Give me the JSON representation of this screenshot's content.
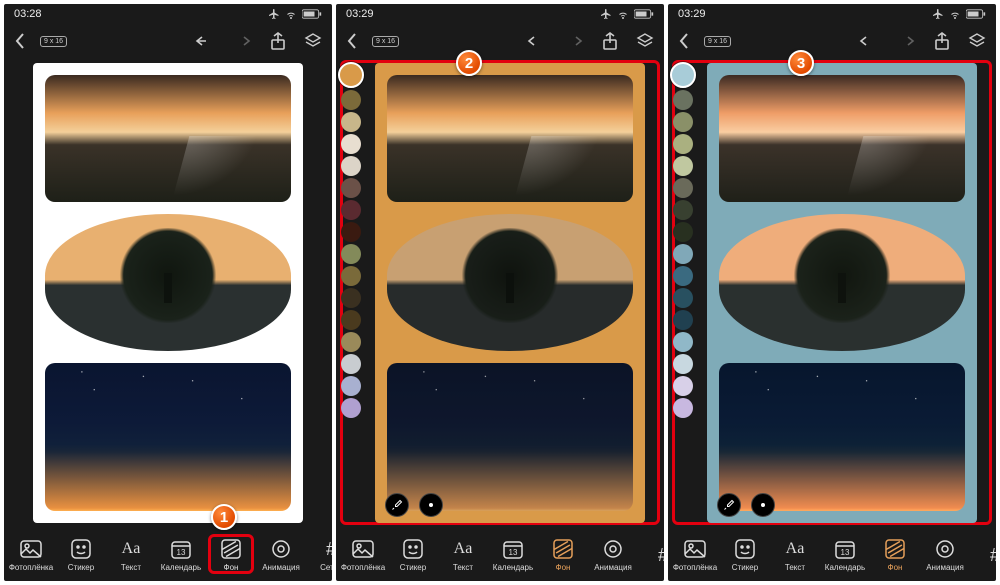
{
  "status": {
    "time1": "03:28",
    "time2": "03:29",
    "time3": "03:29"
  },
  "aspect": {
    "label": "9 x 16"
  },
  "badges": {
    "one": "1",
    "two": "2",
    "three": "3"
  },
  "canvas_bg": {
    "s1": "#ffffff",
    "s2": "#d99a49",
    "s3": "#7fabb8"
  },
  "palette2": [
    "#d99a49",
    "#7b6a3a",
    "#c8b68a",
    "#e8ded0",
    "#dcd4c8",
    "#6b5148",
    "#5a2a30",
    "#3a1a10",
    "#838a5a",
    "#7a6a3a",
    "#3a3020",
    "#4a3a1e",
    "#9a8a5a",
    "#c8ccd0",
    "#a8b0d0",
    "#b0a0d0"
  ],
  "palette3": [
    "#a8ccd8",
    "#6a7260",
    "#8a9068",
    "#aab080",
    "#c0c8a0",
    "#6a6a5a",
    "#384030",
    "#283020",
    "#80a8b8",
    "#3a6a80",
    "#285060",
    "#204050",
    "#90b8c8",
    "#c8d8e0",
    "#d8d0e8",
    "#c8b8e0"
  ],
  "bottombar": {
    "items": [
      {
        "key": "photo",
        "label": "Фотоплёнка"
      },
      {
        "key": "sticker",
        "label": "Стикер"
      },
      {
        "key": "text",
        "label": "Текст"
      },
      {
        "key": "calendar",
        "label": "Календарь",
        "day": "13"
      },
      {
        "key": "bg",
        "label": "Фон"
      },
      {
        "key": "anim",
        "label": "Анимация"
      },
      {
        "key": "grid",
        "label": "Сетка"
      }
    ]
  },
  "eyedropper_label": "eyedropper",
  "dot_label": "о"
}
